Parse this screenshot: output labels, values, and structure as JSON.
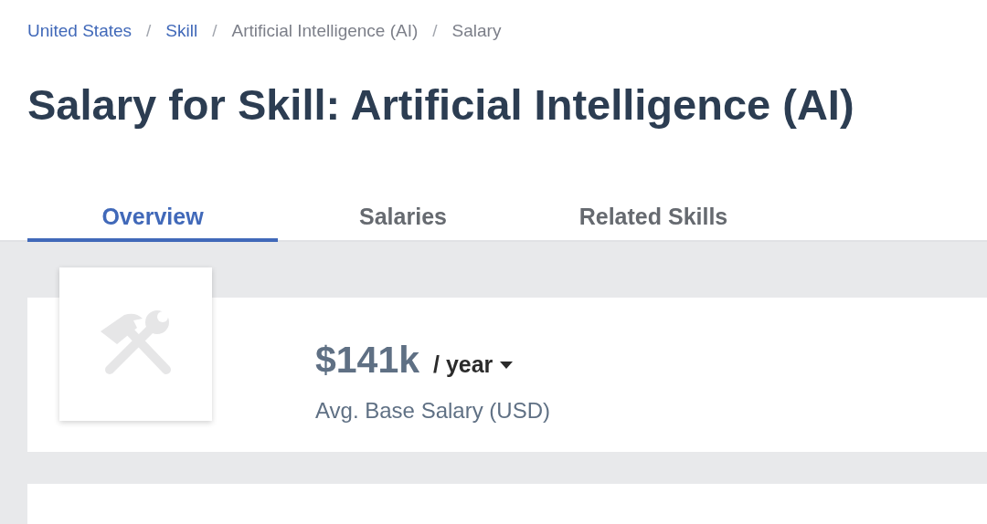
{
  "breadcrumbs": [
    {
      "label": "United States",
      "link": true
    },
    {
      "label": "Skill",
      "link": true
    },
    {
      "label": "Artificial Intelligence (AI)",
      "link": false
    },
    {
      "label": "Salary",
      "link": false
    }
  ],
  "separator": "/",
  "title": "Salary for Skill: Artificial Intelligence (AI)",
  "tabs": [
    {
      "label": "Overview",
      "selected": true
    },
    {
      "label": "Salaries",
      "selected": false
    },
    {
      "label": "Related Skills",
      "selected": false
    }
  ],
  "salary": {
    "amount": "$141k",
    "period": "/ year",
    "caption": "Avg. Base Salary (USD)"
  }
}
